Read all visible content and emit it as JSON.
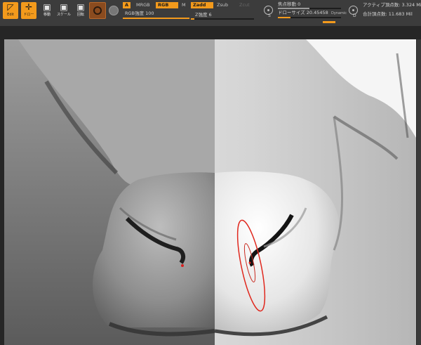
{
  "toolbar": {
    "edit_label": "Edit",
    "draw_label": "ドロー",
    "move_label": "移動",
    "scale_label": "スケール",
    "rotate_label": "回転",
    "a_label": "A",
    "mrgb_label": "MRGB",
    "rgb_label": "RGB",
    "m_label": "M",
    "zadd_label": "Zadd",
    "zsub_label": "Zsub",
    "zcut_label": "Zcut",
    "rgb_intensity": "RGB強度 100",
    "z_intensity": "Z強度 6",
    "rgb_intensity_fill": 1.0,
    "z_intensity_fill": 0.06,
    "focal_shift": "焦点移動 0",
    "draw_size": "ドローサイズ 20.45458",
    "dynamic_label": "Dynamic",
    "focal_shift_fill": 0.5,
    "draw_size_fill": 0.2,
    "s_key": "S",
    "d_key": "D",
    "active_points": "アクティブ頂点数: 3.324 Mil",
    "total_points": "合計頂点数: 11.683 Mil",
    "accent_color": "#f39a1c"
  },
  "viewport": {
    "brush_cursor_color": "#e0281e"
  }
}
